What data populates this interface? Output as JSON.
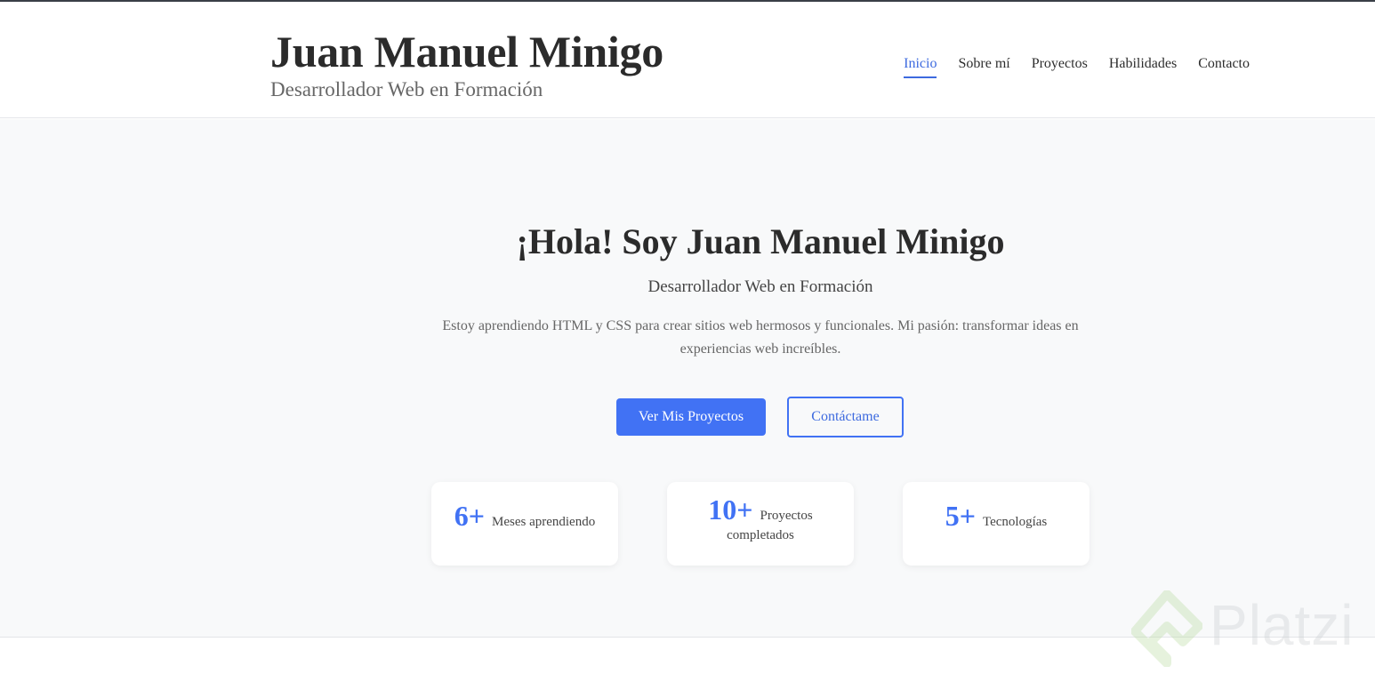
{
  "header": {
    "name": "Juan Manuel Minigo",
    "tagline": "Desarrollador Web en Formación",
    "nav": [
      {
        "label": "Inicio",
        "active": true
      },
      {
        "label": "Sobre mí",
        "active": false
      },
      {
        "label": "Proyectos",
        "active": false
      },
      {
        "label": "Habilidades",
        "active": false
      },
      {
        "label": "Contacto",
        "active": false
      }
    ]
  },
  "hero": {
    "title": "¡Hola! Soy Juan Manuel Minigo",
    "subtitle": "Desarrollador Web en Formación",
    "description": "Estoy aprendiendo HTML y CSS para crear sitios web hermosos y funcionales. Mi pasión: transformar ideas en experiencias web increíbles.",
    "primary_button": "Ver Mis Proyectos",
    "secondary_button": "Contáctame"
  },
  "stats": [
    {
      "number": "6+",
      "label": "Meses aprendiendo"
    },
    {
      "number": "10+",
      "label": "Proyectos completados"
    },
    {
      "number": "5+",
      "label": "Tecnologías"
    }
  ],
  "watermark": {
    "text": "Platzi"
  },
  "colors": {
    "accent": "#4172f4",
    "hero_bg": "#f8f9fa"
  }
}
